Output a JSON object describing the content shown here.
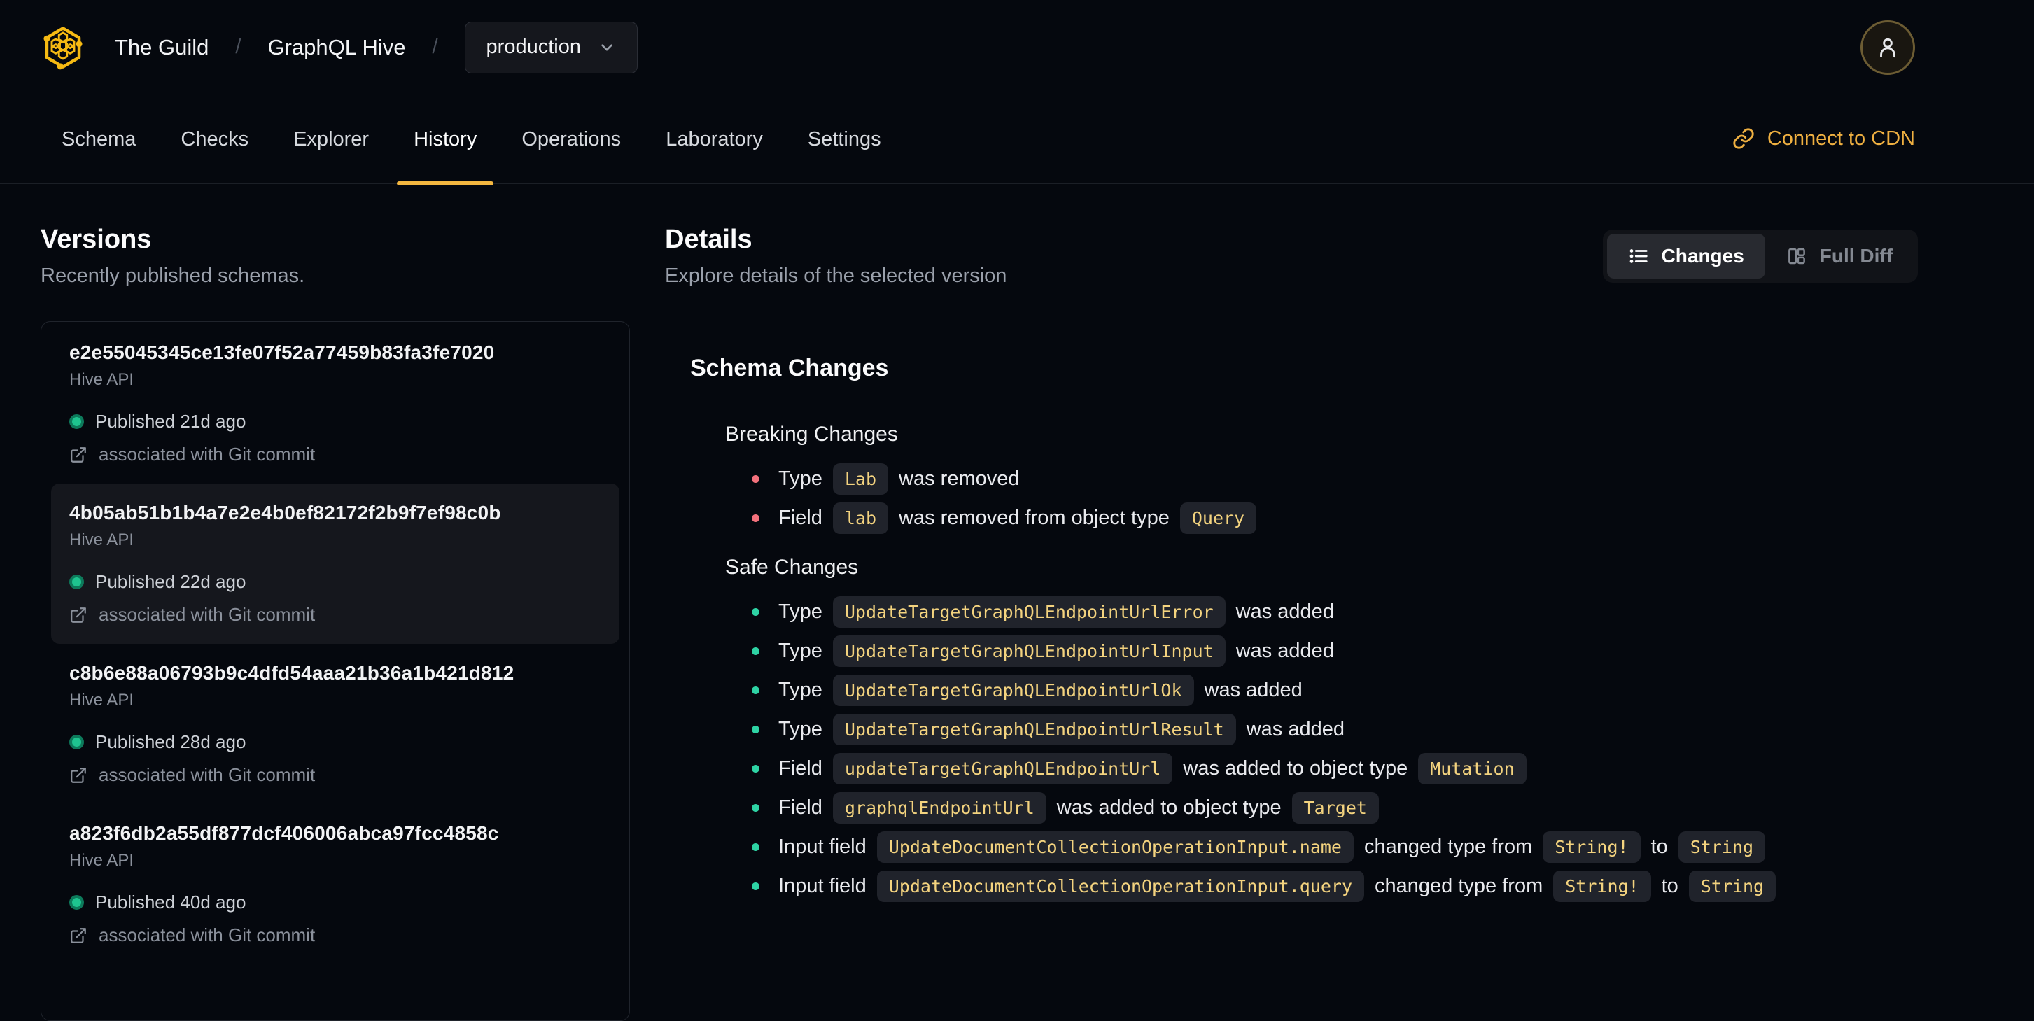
{
  "header": {
    "org": "The Guild",
    "separator1": "/",
    "project": "GraphQL Hive",
    "separator2": "/",
    "target": "production"
  },
  "nav": {
    "tabs": [
      {
        "label": "Schema",
        "active": false
      },
      {
        "label": "Checks",
        "active": false
      },
      {
        "label": "Explorer",
        "active": false
      },
      {
        "label": "History",
        "active": true
      },
      {
        "label": "Operations",
        "active": false
      },
      {
        "label": "Laboratory",
        "active": false
      },
      {
        "label": "Settings",
        "active": false
      }
    ],
    "cdn_link_label": "Connect to CDN"
  },
  "versions": {
    "title": "Versions",
    "subtitle": "Recently published schemas.",
    "items": [
      {
        "hash": "e2e55045345ce13fe07f52a77459b83fa3fe7020",
        "service": "Hive API",
        "status": "Published 21d ago",
        "commit": "associated with Git commit",
        "selected": false
      },
      {
        "hash": "4b05ab51b1b4a7e2e4b0ef82172f2b9f7ef98c0b",
        "service": "Hive API",
        "status": "Published 22d ago",
        "commit": "associated with Git commit",
        "selected": true
      },
      {
        "hash": "c8b6e88a06793b9c4dfd54aaa21b36a1b421d812",
        "service": "Hive API",
        "status": "Published 28d ago",
        "commit": "associated with Git commit",
        "selected": false
      },
      {
        "hash": "a823f6db2a55df877dcf406006abca97fcc4858c",
        "service": "Hive API",
        "status": "Published 40d ago",
        "commit": "associated with Git commit",
        "selected": false
      }
    ]
  },
  "details": {
    "title": "Details",
    "subtitle": "Explore details of the selected version",
    "view_toggle": {
      "changes_label": "Changes",
      "full_diff_label": "Full Diff",
      "active": "Changes"
    },
    "schema_changes": {
      "title": "Schema Changes",
      "sections": [
        {
          "title": "Breaking Changes",
          "severity": "breaking",
          "items": [
            [
              {
                "t": "text",
                "v": "Type"
              },
              {
                "t": "code",
                "v": "Lab"
              },
              {
                "t": "text",
                "v": "was removed"
              }
            ],
            [
              {
                "t": "text",
                "v": "Field"
              },
              {
                "t": "code",
                "v": "lab"
              },
              {
                "t": "text",
                "v": "was removed from object type"
              },
              {
                "t": "code",
                "v": "Query"
              }
            ]
          ]
        },
        {
          "title": "Safe Changes",
          "severity": "safe",
          "items": [
            [
              {
                "t": "text",
                "v": "Type"
              },
              {
                "t": "code",
                "v": "UpdateTargetGraphQLEndpointUrlError"
              },
              {
                "t": "text",
                "v": "was added"
              }
            ],
            [
              {
                "t": "text",
                "v": "Type"
              },
              {
                "t": "code",
                "v": "UpdateTargetGraphQLEndpointUrlInput"
              },
              {
                "t": "text",
                "v": "was added"
              }
            ],
            [
              {
                "t": "text",
                "v": "Type"
              },
              {
                "t": "code",
                "v": "UpdateTargetGraphQLEndpointUrlOk"
              },
              {
                "t": "text",
                "v": "was added"
              }
            ],
            [
              {
                "t": "text",
                "v": "Type"
              },
              {
                "t": "code",
                "v": "UpdateTargetGraphQLEndpointUrlResult"
              },
              {
                "t": "text",
                "v": "was added"
              }
            ],
            [
              {
                "t": "text",
                "v": "Field"
              },
              {
                "t": "code",
                "v": "updateTargetGraphQLEndpointUrl"
              },
              {
                "t": "text",
                "v": "was added to object type"
              },
              {
                "t": "code",
                "v": "Mutation"
              }
            ],
            [
              {
                "t": "text",
                "v": "Field"
              },
              {
                "t": "code",
                "v": "graphqlEndpointUrl"
              },
              {
                "t": "text",
                "v": "was added to object type"
              },
              {
                "t": "code",
                "v": "Target"
              }
            ],
            [
              {
                "t": "text",
                "v": "Input field"
              },
              {
                "t": "code",
                "v": "UpdateDocumentCollectionOperationInput.name"
              },
              {
                "t": "text",
                "v": "changed type from"
              },
              {
                "t": "code",
                "v": "String!"
              },
              {
                "t": "text",
                "v": "to"
              },
              {
                "t": "code",
                "v": "String"
              }
            ],
            [
              {
                "t": "text",
                "v": "Input field"
              },
              {
                "t": "code",
                "v": "UpdateDocumentCollectionOperationInput.query"
              },
              {
                "t": "text",
                "v": "changed type from"
              },
              {
                "t": "code",
                "v": "String!"
              },
              {
                "t": "text",
                "v": "to"
              },
              {
                "t": "code",
                "v": "String"
              }
            ]
          ]
        }
      ]
    }
  },
  "colors": {
    "background": "#05080e",
    "accent_amber": "#f4b740",
    "cdn_amber": "#efb041",
    "published_green": "#1ec48f",
    "breaking_red": "#f3717c",
    "safe_green": "#2ed3a4",
    "code_text": "#f3d37f",
    "code_bg": "#20232b",
    "selected_item_bg": "#15171d"
  }
}
